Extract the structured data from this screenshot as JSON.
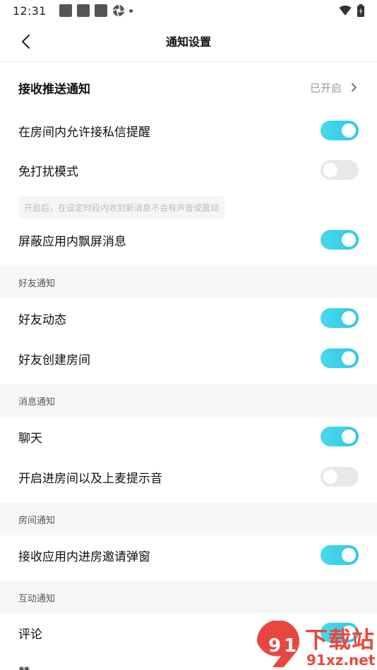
{
  "status_bar": {
    "time": "12:31"
  },
  "nav": {
    "title": "通知设置"
  },
  "push": {
    "label": "接收推送通知",
    "status": "已开启"
  },
  "settings": {
    "private_msg": {
      "label": "在房间内允许接私信提醒",
      "on": true
    },
    "dnd": {
      "label": "免打扰模式",
      "on": false,
      "hint": "开启后，在设定时段内收到新消息不会有声音或震动"
    },
    "block_float": {
      "label": "屏蔽应用内飘屏消息",
      "on": true
    }
  },
  "sections": {
    "friends": {
      "title": "好友通知",
      "items": [
        {
          "label": "好友动态",
          "on": true
        },
        {
          "label": "好友创建房间",
          "on": true
        }
      ]
    },
    "messages": {
      "title": "消息通知",
      "items": [
        {
          "label": "聊天",
          "on": true
        },
        {
          "label": "开启进房间以及上麦提示音",
          "on": false
        }
      ]
    },
    "room": {
      "title": "房间通知",
      "items": [
        {
          "label": "接收应用内进房邀请弹窗",
          "on": true
        }
      ]
    },
    "interaction": {
      "title": "互动通知",
      "items": [
        {
          "label": "评论",
          "on": true
        },
        {
          "label": "赞",
          "on": true
        }
      ]
    }
  },
  "watermark": {
    "brand": "下载站",
    "url": "91xz.net"
  },
  "colors": {
    "accent": "#2ec8e6",
    "toggle_off": "#e8e8e8",
    "section_bg": "#f7f7f7",
    "hint_text": "#bdbdbd"
  }
}
